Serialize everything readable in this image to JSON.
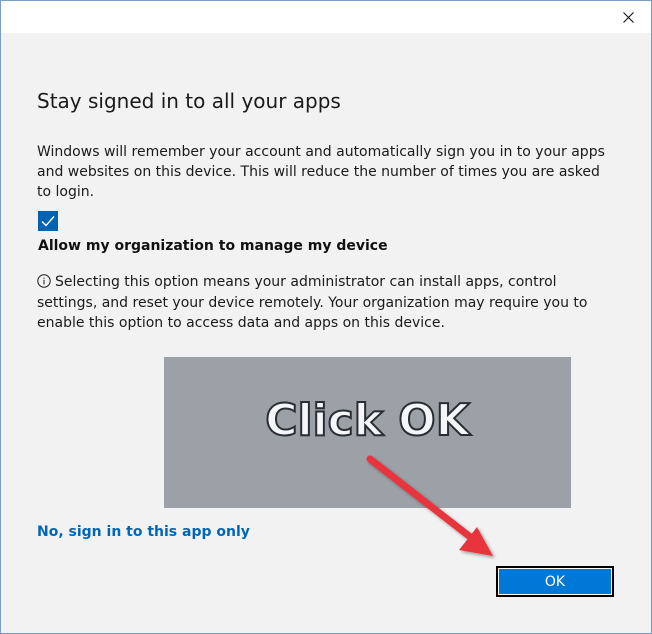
{
  "dialog": {
    "heading": "Stay signed in to all your apps",
    "description": "Windows will remember your account and automatically sign you in to your apps and websites on this device. This will reduce the number of times you are asked to login.",
    "checkbox": {
      "checked": true,
      "label": "Allow my organization to manage my device"
    },
    "info_text": "Selecting this option means your administrator can install apps, control settings, and reset your device remotely. Your organization may require you to enable this option to access data and apps on this device.",
    "link_text": "No, sign in to this app only",
    "ok_label": "OK"
  },
  "annotation": {
    "text": "Click OK",
    "arrow_color": "#e8353c"
  },
  "colors": {
    "accent": "#0078d7",
    "link": "#0067b8",
    "overlay": "#9ca1a8"
  },
  "icons": {
    "close": "close-icon",
    "check": "checkmark-icon",
    "info": "info-icon"
  }
}
